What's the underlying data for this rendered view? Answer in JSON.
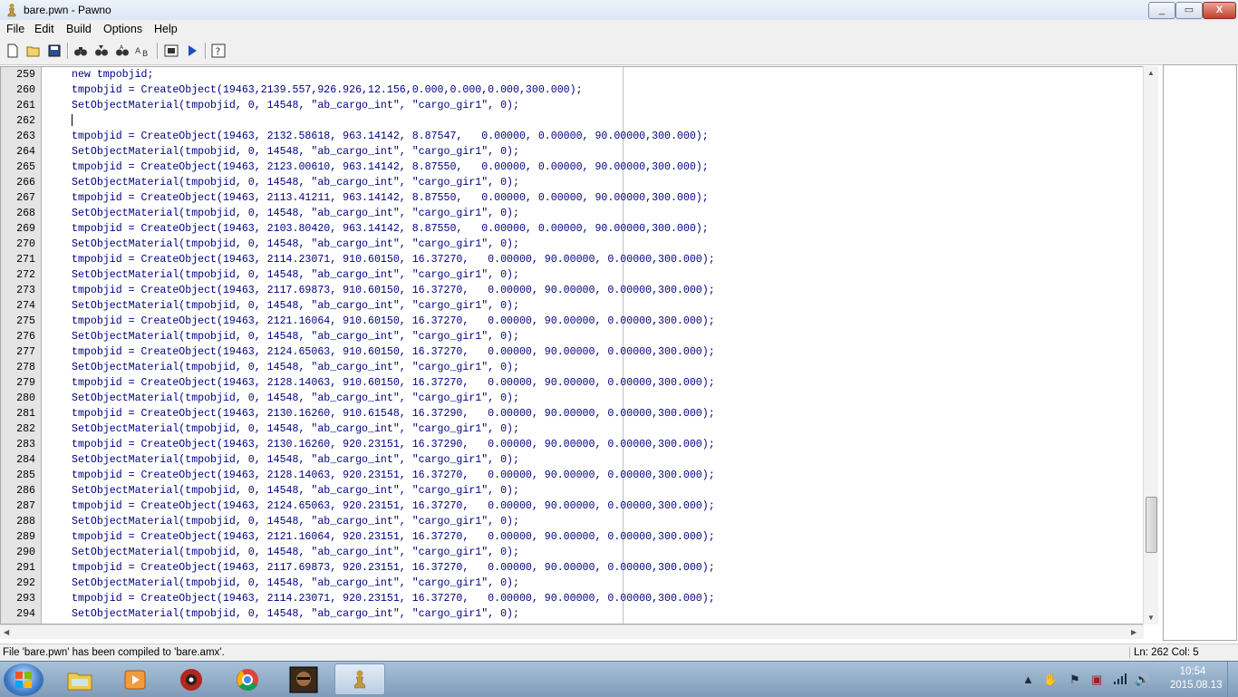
{
  "window": {
    "title": "bare.pwn - Pawno",
    "buttons": [
      "_",
      "▭",
      "X"
    ]
  },
  "menu": [
    "File",
    "Edit",
    "Build",
    "Options",
    "Help"
  ],
  "toolbar": [
    "new-file-icon",
    "open-file-icon",
    "save-icon",
    "find-icon",
    "find-next-icon",
    "replace-icon",
    "goto-line-icon",
    "compile-icon",
    "run-icon",
    "help-icon"
  ],
  "editor": {
    "lines": [
      {
        "n": "259",
        "t": "new tmpobjid;"
      },
      {
        "n": "260",
        "t": "tmpobjid = CreateObject(19463,2139.557,926.926,12.156,0.000,0.000,0.000,300.000);"
      },
      {
        "n": "261",
        "t": "SetObjectMaterial(tmpobjid, 0, 14548, \"ab_cargo_int\", \"cargo_gir1\", 0);"
      },
      {
        "n": "262",
        "t": ""
      },
      {
        "n": "263",
        "t": "tmpobjid = CreateObject(19463, 2132.58618, 963.14142, 8.87547,   0.00000, 0.00000, 90.00000,300.000);"
      },
      {
        "n": "264",
        "t": "SetObjectMaterial(tmpobjid, 0, 14548, \"ab_cargo_int\", \"cargo_gir1\", 0);"
      },
      {
        "n": "265",
        "t": "tmpobjid = CreateObject(19463, 2123.00610, 963.14142, 8.87550,   0.00000, 0.00000, 90.00000,300.000);"
      },
      {
        "n": "266",
        "t": "SetObjectMaterial(tmpobjid, 0, 14548, \"ab_cargo_int\", \"cargo_gir1\", 0);"
      },
      {
        "n": "267",
        "t": "tmpobjid = CreateObject(19463, 2113.41211, 963.14142, 8.87550,   0.00000, 0.00000, 90.00000,300.000);"
      },
      {
        "n": "268",
        "t": "SetObjectMaterial(tmpobjid, 0, 14548, \"ab_cargo_int\", \"cargo_gir1\", 0);"
      },
      {
        "n": "269",
        "t": "tmpobjid = CreateObject(19463, 2103.80420, 963.14142, 8.87550,   0.00000, 0.00000, 90.00000,300.000);"
      },
      {
        "n": "270",
        "t": "SetObjectMaterial(tmpobjid, 0, 14548, \"ab_cargo_int\", \"cargo_gir1\", 0);"
      },
      {
        "n": "271",
        "t": "tmpobjid = CreateObject(19463, 2114.23071, 910.60150, 16.37270,   0.00000, 90.00000, 0.00000,300.000);"
      },
      {
        "n": "272",
        "t": "SetObjectMaterial(tmpobjid, 0, 14548, \"ab_cargo_int\", \"cargo_gir1\", 0);"
      },
      {
        "n": "273",
        "t": "tmpobjid = CreateObject(19463, 2117.69873, 910.60150, 16.37270,   0.00000, 90.00000, 0.00000,300.000);"
      },
      {
        "n": "274",
        "t": "SetObjectMaterial(tmpobjid, 0, 14548, \"ab_cargo_int\", \"cargo_gir1\", 0);"
      },
      {
        "n": "275",
        "t": "tmpobjid = CreateObject(19463, 2121.16064, 910.60150, 16.37270,   0.00000, 90.00000, 0.00000,300.000);"
      },
      {
        "n": "276",
        "t": "SetObjectMaterial(tmpobjid, 0, 14548, \"ab_cargo_int\", \"cargo_gir1\", 0);"
      },
      {
        "n": "277",
        "t": "tmpobjid = CreateObject(19463, 2124.65063, 910.60150, 16.37270,   0.00000, 90.00000, 0.00000,300.000);"
      },
      {
        "n": "278",
        "t": "SetObjectMaterial(tmpobjid, 0, 14548, \"ab_cargo_int\", \"cargo_gir1\", 0);"
      },
      {
        "n": "279",
        "t": "tmpobjid = CreateObject(19463, 2128.14063, 910.60150, 16.37270,   0.00000, 90.00000, 0.00000,300.000);"
      },
      {
        "n": "280",
        "t": "SetObjectMaterial(tmpobjid, 0, 14548, \"ab_cargo_int\", \"cargo_gir1\", 0);"
      },
      {
        "n": "281",
        "t": "tmpobjid = CreateObject(19463, 2130.16260, 910.61548, 16.37290,   0.00000, 90.00000, 0.00000,300.000);"
      },
      {
        "n": "282",
        "t": "SetObjectMaterial(tmpobjid, 0, 14548, \"ab_cargo_int\", \"cargo_gir1\", 0);"
      },
      {
        "n": "283",
        "t": "tmpobjid = CreateObject(19463, 2130.16260, 920.23151, 16.37290,   0.00000, 90.00000, 0.00000,300.000);"
      },
      {
        "n": "284",
        "t": "SetObjectMaterial(tmpobjid, 0, 14548, \"ab_cargo_int\", \"cargo_gir1\", 0);"
      },
      {
        "n": "285",
        "t": "tmpobjid = CreateObject(19463, 2128.14063, 920.23151, 16.37270,   0.00000, 90.00000, 0.00000,300.000);"
      },
      {
        "n": "286",
        "t": "SetObjectMaterial(tmpobjid, 0, 14548, \"ab_cargo_int\", \"cargo_gir1\", 0);"
      },
      {
        "n": "287",
        "t": "tmpobjid = CreateObject(19463, 2124.65063, 920.23151, 16.37270,   0.00000, 90.00000, 0.00000,300.000);"
      },
      {
        "n": "288",
        "t": "SetObjectMaterial(tmpobjid, 0, 14548, \"ab_cargo_int\", \"cargo_gir1\", 0);"
      },
      {
        "n": "289",
        "t": "tmpobjid = CreateObject(19463, 2121.16064, 920.23151, 16.37270,   0.00000, 90.00000, 0.00000,300.000);"
      },
      {
        "n": "290",
        "t": "SetObjectMaterial(tmpobjid, 0, 14548, \"ab_cargo_int\", \"cargo_gir1\", 0);"
      },
      {
        "n": "291",
        "t": "tmpobjid = CreateObject(19463, 2117.69873, 920.23151, 16.37270,   0.00000, 90.00000, 0.00000,300.000);"
      },
      {
        "n": "292",
        "t": "SetObjectMaterial(tmpobjid, 0, 14548, \"ab_cargo_int\", \"cargo_gir1\", 0);"
      },
      {
        "n": "293",
        "t": "tmpobjid = CreateObject(19463, 2114.23071, 920.23151, 16.37270,   0.00000, 90.00000, 0.00000,300.000);"
      },
      {
        "n": "294",
        "t": "SetObjectMaterial(tmpobjid, 0, 14548, \"ab_cargo_int\", \"cargo_gir1\", 0);"
      }
    ]
  },
  "status": {
    "message": "File 'bare.pwn' has been compiled to 'bare.amx'.",
    "position": "Ln: 262   Col: 5"
  },
  "taskbar": {
    "apps": [
      "explorer-icon",
      "media-player-icon",
      "app-gear-icon",
      "chrome-icon",
      "game-icon",
      "pawno-icon"
    ],
    "clock_time": "10:54",
    "clock_date": "2015.08.13"
  },
  "colors": {
    "titlebar": "#dbe6f4",
    "gutter": "#e4e4e4",
    "code_text": "#000080",
    "taskbar": "#8eaac6"
  }
}
